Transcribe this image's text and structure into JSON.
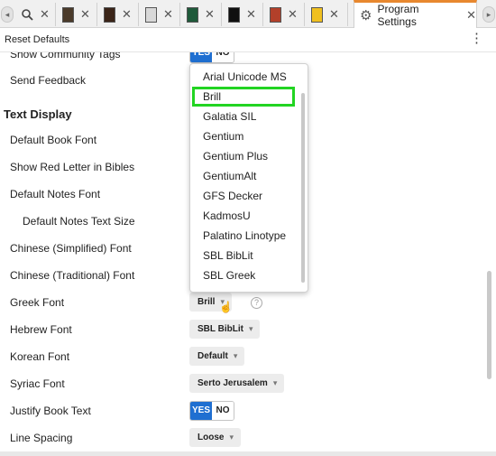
{
  "tabs": {
    "program_settings_label": "Program Settings",
    "close_glyph": "✕",
    "thumb_colors": [
      "#4a3a2a",
      "#3a2418",
      "#d8d8d8",
      "#1f5a3a",
      "#101010",
      "#b2402a",
      "#f0c020"
    ]
  },
  "toolbar": {
    "reset_label": "Reset Defaults"
  },
  "rows": {
    "show_community_tags": "Show Community Tags",
    "send_feedback": "Send Feedback",
    "section_text_display": "Text Display",
    "default_book_font": "Default Book Font",
    "show_red_letter": "Show Red Letter in Bibles",
    "default_notes_font": "Default Notes Font",
    "default_notes_text_size": "Default Notes Text Size",
    "chinese_simplified_font": "Chinese (Simplified) Font",
    "chinese_traditional_font": "Chinese (Traditional) Font",
    "greek_font": "Greek Font",
    "hebrew_font": "Hebrew Font",
    "korean_font": "Korean Font",
    "syriac_font": "Syriac Font",
    "justify_book_text": "Justify Book Text",
    "line_spacing": "Line Spacing"
  },
  "controls": {
    "yes": "YES",
    "no": "NO",
    "greek_value": "Brill",
    "hebrew_value": "SBL BibLit",
    "korean_value": "Default",
    "syriac_value": "Serto Jerusalem",
    "line_spacing_value": "Loose",
    "help_glyph": "?"
  },
  "font_menu": {
    "items": [
      "Arial Unicode MS",
      "Brill",
      "Galatia SIL",
      "Gentium",
      "Gentium Plus",
      "GentiumAlt",
      "GFS Decker",
      "KadmosU",
      "Palatino Linotype",
      "SBL BibLit",
      "SBL Greek"
    ],
    "highlighted": "Brill",
    "highlight_color": "#22d422"
  },
  "accent_color": "#e8882f",
  "toggle_on_color": "#1f6fd1"
}
